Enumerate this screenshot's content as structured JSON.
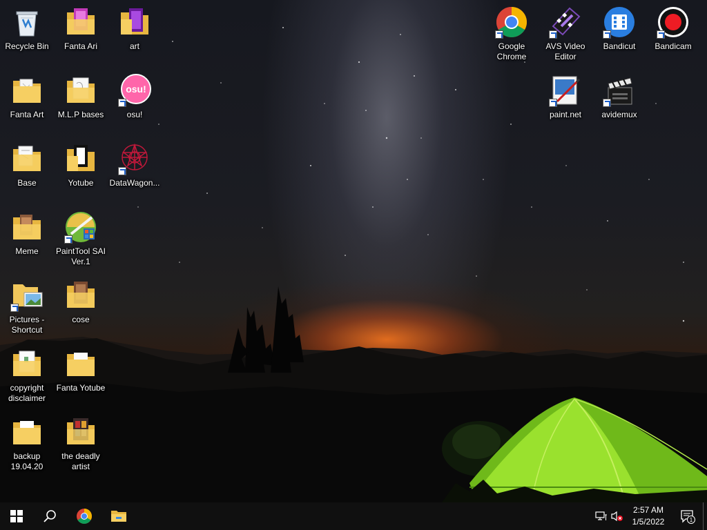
{
  "desktop": {
    "icons": [
      {
        "label": "Recycle Bin",
        "icon": "recycle-bin-icon"
      },
      {
        "label": "Fanta Ari",
        "icon": "folder-icon"
      },
      {
        "label": "art",
        "icon": "folder-icon"
      },
      {
        "label": "Fanta Art",
        "icon": "folder-icon"
      },
      {
        "label": "M.L.P bases",
        "icon": "folder-icon"
      },
      {
        "label": "osu!",
        "icon": "osu-icon",
        "badge": "osu!"
      },
      {
        "label": "Base",
        "icon": "folder-icon"
      },
      {
        "label": "Yotube",
        "icon": "folder-icon"
      },
      {
        "label": "DataWagon...",
        "icon": "datawagon-icon"
      },
      {
        "label": "Meme",
        "icon": "folder-icon"
      },
      {
        "label": "PaintTool SAI\nVer.1",
        "icon": "painttool-sai-icon"
      },
      {
        "label": "Pictures -\nShortcut",
        "icon": "pictures-shortcut-icon"
      },
      {
        "label": "cose",
        "icon": "folder-icon"
      },
      {
        "label": "copyright\ndisclaimer",
        "icon": "document-icon"
      },
      {
        "label": "Fanta Yotube",
        "icon": "folder-icon"
      },
      {
        "label": "backup\n19.04.20",
        "icon": "folder-icon"
      },
      {
        "label": "the deadly\nartist",
        "icon": "folder-icon"
      },
      {
        "label": "Google\nChrome",
        "icon": "chrome-icon"
      },
      {
        "label": "AVS Video\nEditor",
        "icon": "avs-video-editor-icon"
      },
      {
        "label": "Bandicut",
        "icon": "bandicut-icon"
      },
      {
        "label": "Bandicam",
        "icon": "bandicam-icon"
      },
      {
        "label": "paint.net",
        "icon": "paint-net-icon"
      },
      {
        "label": "avidemux",
        "icon": "avidemux-icon"
      }
    ]
  },
  "taskbar": {
    "start": "windows-logo-icon",
    "search": "search-icon",
    "pinned": [
      "chrome-icon",
      "file-explorer-icon"
    ],
    "tray": [
      "network-icon",
      "volume-muted-icon"
    ],
    "clock": {
      "time": "2:57 AM",
      "date": "1/5/2022"
    },
    "notification_count": "1"
  },
  "colors": {
    "taskbar": "#101010",
    "folder": "#f1c75b",
    "tent": "#8fd62a",
    "horizon": "#ff7a1e"
  }
}
